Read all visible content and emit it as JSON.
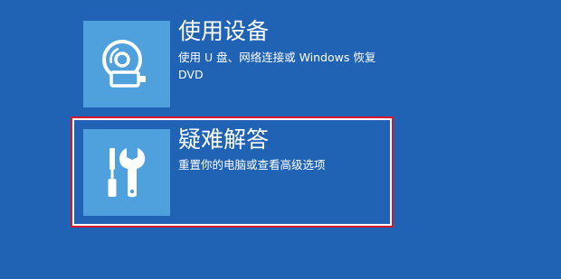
{
  "options": [
    {
      "title": "使用设备",
      "description": "使用 U 盘、网络连接或 Windows 恢复 DVD",
      "icon": "disc-usb-icon",
      "selected": false
    },
    {
      "title": "疑难解答",
      "description": "重置你的电脑或查看高级选项",
      "icon": "tools-icon",
      "selected": true
    }
  ],
  "colors": {
    "background": "#2063b5",
    "tile": "#4ea1dd",
    "selection_outline": "#d21a2c",
    "text": "#ffffff"
  }
}
